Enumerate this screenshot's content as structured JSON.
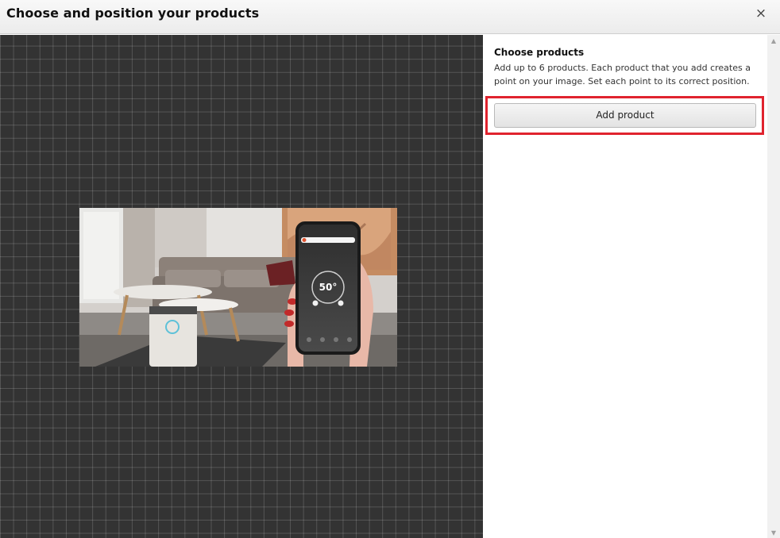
{
  "dialog": {
    "title": "Choose and position your products",
    "close_label": "×"
  },
  "panel": {
    "heading": "Choose products",
    "description": "Add up to 6 products. Each product that you add creates a point on your image. Set each point to its correct position.",
    "add_product_label": "Add product"
  },
  "image": {
    "phone_temperature": "50°"
  },
  "scrollbar": {
    "up_glyph": "▲",
    "down_glyph": "▼"
  },
  "colors": {
    "canvas_background": "#333333",
    "highlight": "#e0232e"
  }
}
